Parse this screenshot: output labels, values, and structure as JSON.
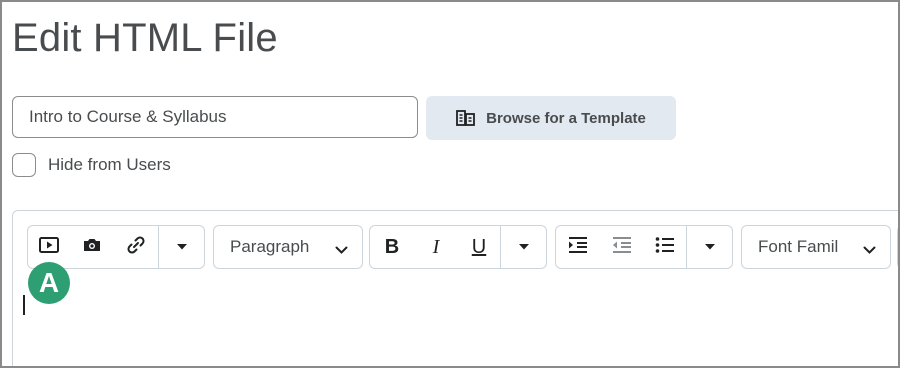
{
  "page": {
    "title": "Edit HTML File"
  },
  "form": {
    "title_value": "Intro to Course & Syllabus",
    "browse_label": "Browse for a Template",
    "hide_label": "Hide from Users",
    "hide_checked": false
  },
  "toolbar": {
    "insert_group": [
      "insert-stuff-icon",
      "insert-image-icon",
      "insert-link-icon",
      "more-chevron-icon"
    ],
    "block_format": "Paragraph",
    "format_buttons": [
      {
        "icon": "bold-icon",
        "label": "B"
      },
      {
        "icon": "italic-icon",
        "label": "I"
      },
      {
        "icon": "underline-icon",
        "label": "U"
      }
    ],
    "list_group": [
      "indent-icon",
      "outdent-icon",
      "bullet-list-icon",
      "more-chevron-icon"
    ],
    "font_family": "Font Famil"
  },
  "annotation": {
    "badge": "A",
    "color": "#2e9e73"
  },
  "colors": {
    "text": "#494c4e",
    "button_bg": "#e3e9f1",
    "border": "#cdd5dc"
  }
}
